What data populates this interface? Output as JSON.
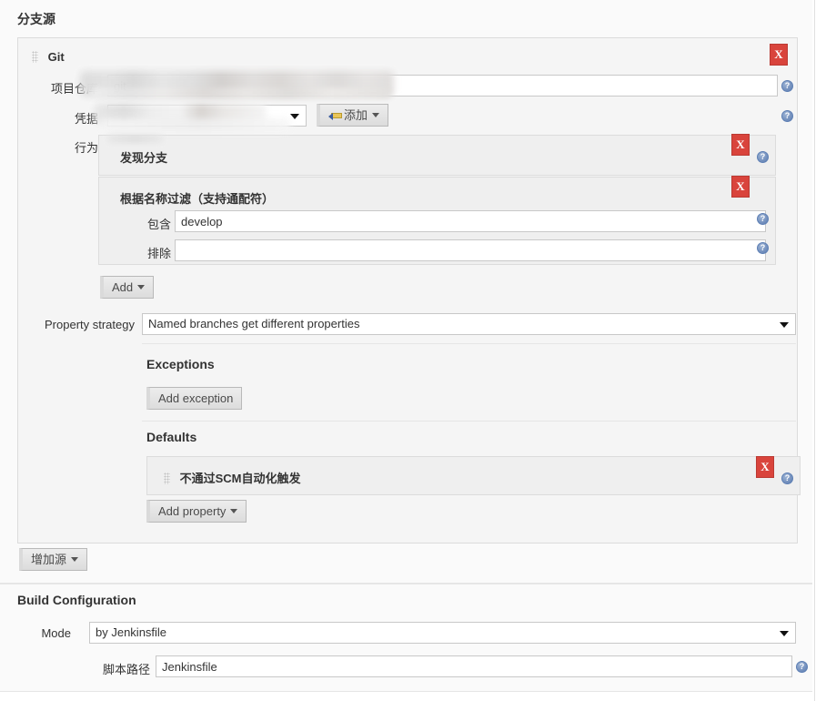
{
  "sections": {
    "branch_sources": {
      "title": "分支源",
      "source": {
        "name": "Git",
        "remove_label": "X",
        "fields": {
          "repository": {
            "label": "项目仓库",
            "value": "git"
          },
          "credentials": {
            "label": "凭据",
            "value": "",
            "add_label": "添加"
          },
          "behaviours": {
            "label": "行为"
          }
        },
        "behaviours": [
          {
            "title": "发现分支",
            "remove_label": "X"
          },
          {
            "title": "根据名称过滤（支持通配符）",
            "remove_label": "X",
            "fields": [
              {
                "label": "包含",
                "value": "develop"
              },
              {
                "label": "排除",
                "value": ""
              }
            ]
          }
        ],
        "behaviours_add_label": "Add",
        "property_strategy": {
          "label": "Property strategy",
          "value": "Named branches get different properties",
          "exceptions_title": "Exceptions",
          "add_exception_label": "Add exception",
          "defaults_title": "Defaults",
          "default_properties": [
            {
              "title": "不通过SCM自动化触发",
              "remove_label": "X"
            }
          ],
          "add_property_label": "Add property"
        }
      },
      "add_source_label": "增加源"
    },
    "build_configuration": {
      "title": "Build Configuration",
      "mode": {
        "label": "Mode",
        "value": "by Jenkinsfile"
      },
      "script_path": {
        "label": "脚本路径",
        "value": "Jenkinsfile"
      }
    }
  },
  "colors": {
    "danger": "#d9443c",
    "help": "#5b7bb0",
    "panel_bg": "#f5f5f5",
    "page_bg": "#fafafa"
  }
}
